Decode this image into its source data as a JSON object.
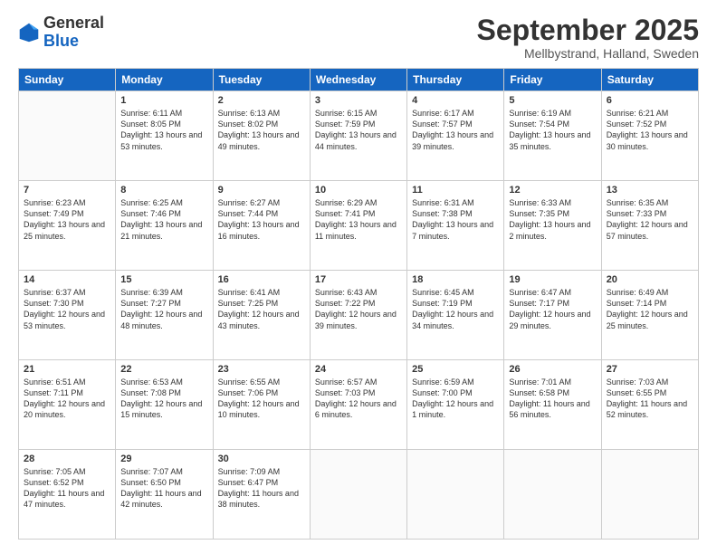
{
  "header": {
    "logo": {
      "line1": "General",
      "line2": "Blue"
    },
    "title": "September 2025",
    "location": "Mellbystrand, Halland, Sweden"
  },
  "weekdays": [
    "Sunday",
    "Monday",
    "Tuesday",
    "Wednesday",
    "Thursday",
    "Friday",
    "Saturday"
  ],
  "weeks": [
    [
      {
        "day": "",
        "sunrise": "",
        "sunset": "",
        "daylight": ""
      },
      {
        "day": "1",
        "sunrise": "Sunrise: 6:11 AM",
        "sunset": "Sunset: 8:05 PM",
        "daylight": "Daylight: 13 hours and 53 minutes."
      },
      {
        "day": "2",
        "sunrise": "Sunrise: 6:13 AM",
        "sunset": "Sunset: 8:02 PM",
        "daylight": "Daylight: 13 hours and 49 minutes."
      },
      {
        "day": "3",
        "sunrise": "Sunrise: 6:15 AM",
        "sunset": "Sunset: 7:59 PM",
        "daylight": "Daylight: 13 hours and 44 minutes."
      },
      {
        "day": "4",
        "sunrise": "Sunrise: 6:17 AM",
        "sunset": "Sunset: 7:57 PM",
        "daylight": "Daylight: 13 hours and 39 minutes."
      },
      {
        "day": "5",
        "sunrise": "Sunrise: 6:19 AM",
        "sunset": "Sunset: 7:54 PM",
        "daylight": "Daylight: 13 hours and 35 minutes."
      },
      {
        "day": "6",
        "sunrise": "Sunrise: 6:21 AM",
        "sunset": "Sunset: 7:52 PM",
        "daylight": "Daylight: 13 hours and 30 minutes."
      }
    ],
    [
      {
        "day": "7",
        "sunrise": "Sunrise: 6:23 AM",
        "sunset": "Sunset: 7:49 PM",
        "daylight": "Daylight: 13 hours and 25 minutes."
      },
      {
        "day": "8",
        "sunrise": "Sunrise: 6:25 AM",
        "sunset": "Sunset: 7:46 PM",
        "daylight": "Daylight: 13 hours and 21 minutes."
      },
      {
        "day": "9",
        "sunrise": "Sunrise: 6:27 AM",
        "sunset": "Sunset: 7:44 PM",
        "daylight": "Daylight: 13 hours and 16 minutes."
      },
      {
        "day": "10",
        "sunrise": "Sunrise: 6:29 AM",
        "sunset": "Sunset: 7:41 PM",
        "daylight": "Daylight: 13 hours and 11 minutes."
      },
      {
        "day": "11",
        "sunrise": "Sunrise: 6:31 AM",
        "sunset": "Sunset: 7:38 PM",
        "daylight": "Daylight: 13 hours and 7 minutes."
      },
      {
        "day": "12",
        "sunrise": "Sunrise: 6:33 AM",
        "sunset": "Sunset: 7:35 PM",
        "daylight": "Daylight: 13 hours and 2 minutes."
      },
      {
        "day": "13",
        "sunrise": "Sunrise: 6:35 AM",
        "sunset": "Sunset: 7:33 PM",
        "daylight": "Daylight: 12 hours and 57 minutes."
      }
    ],
    [
      {
        "day": "14",
        "sunrise": "Sunrise: 6:37 AM",
        "sunset": "Sunset: 7:30 PM",
        "daylight": "Daylight: 12 hours and 53 minutes."
      },
      {
        "day": "15",
        "sunrise": "Sunrise: 6:39 AM",
        "sunset": "Sunset: 7:27 PM",
        "daylight": "Daylight: 12 hours and 48 minutes."
      },
      {
        "day": "16",
        "sunrise": "Sunrise: 6:41 AM",
        "sunset": "Sunset: 7:25 PM",
        "daylight": "Daylight: 12 hours and 43 minutes."
      },
      {
        "day": "17",
        "sunrise": "Sunrise: 6:43 AM",
        "sunset": "Sunset: 7:22 PM",
        "daylight": "Daylight: 12 hours and 39 minutes."
      },
      {
        "day": "18",
        "sunrise": "Sunrise: 6:45 AM",
        "sunset": "Sunset: 7:19 PM",
        "daylight": "Daylight: 12 hours and 34 minutes."
      },
      {
        "day": "19",
        "sunrise": "Sunrise: 6:47 AM",
        "sunset": "Sunset: 7:17 PM",
        "daylight": "Daylight: 12 hours and 29 minutes."
      },
      {
        "day": "20",
        "sunrise": "Sunrise: 6:49 AM",
        "sunset": "Sunset: 7:14 PM",
        "daylight": "Daylight: 12 hours and 25 minutes."
      }
    ],
    [
      {
        "day": "21",
        "sunrise": "Sunrise: 6:51 AM",
        "sunset": "Sunset: 7:11 PM",
        "daylight": "Daylight: 12 hours and 20 minutes."
      },
      {
        "day": "22",
        "sunrise": "Sunrise: 6:53 AM",
        "sunset": "Sunset: 7:08 PM",
        "daylight": "Daylight: 12 hours and 15 minutes."
      },
      {
        "day": "23",
        "sunrise": "Sunrise: 6:55 AM",
        "sunset": "Sunset: 7:06 PM",
        "daylight": "Daylight: 12 hours and 10 minutes."
      },
      {
        "day": "24",
        "sunrise": "Sunrise: 6:57 AM",
        "sunset": "Sunset: 7:03 PM",
        "daylight": "Daylight: 12 hours and 6 minutes."
      },
      {
        "day": "25",
        "sunrise": "Sunrise: 6:59 AM",
        "sunset": "Sunset: 7:00 PM",
        "daylight": "Daylight: 12 hours and 1 minute."
      },
      {
        "day": "26",
        "sunrise": "Sunrise: 7:01 AM",
        "sunset": "Sunset: 6:58 PM",
        "daylight": "Daylight: 11 hours and 56 minutes."
      },
      {
        "day": "27",
        "sunrise": "Sunrise: 7:03 AM",
        "sunset": "Sunset: 6:55 PM",
        "daylight": "Daylight: 11 hours and 52 minutes."
      }
    ],
    [
      {
        "day": "28",
        "sunrise": "Sunrise: 7:05 AM",
        "sunset": "Sunset: 6:52 PM",
        "daylight": "Daylight: 11 hours and 47 minutes."
      },
      {
        "day": "29",
        "sunrise": "Sunrise: 7:07 AM",
        "sunset": "Sunset: 6:50 PM",
        "daylight": "Daylight: 11 hours and 42 minutes."
      },
      {
        "day": "30",
        "sunrise": "Sunrise: 7:09 AM",
        "sunset": "Sunset: 6:47 PM",
        "daylight": "Daylight: 11 hours and 38 minutes."
      },
      {
        "day": "",
        "sunrise": "",
        "sunset": "",
        "daylight": ""
      },
      {
        "day": "",
        "sunrise": "",
        "sunset": "",
        "daylight": ""
      },
      {
        "day": "",
        "sunrise": "",
        "sunset": "",
        "daylight": ""
      },
      {
        "day": "",
        "sunrise": "",
        "sunset": "",
        "daylight": ""
      }
    ]
  ]
}
